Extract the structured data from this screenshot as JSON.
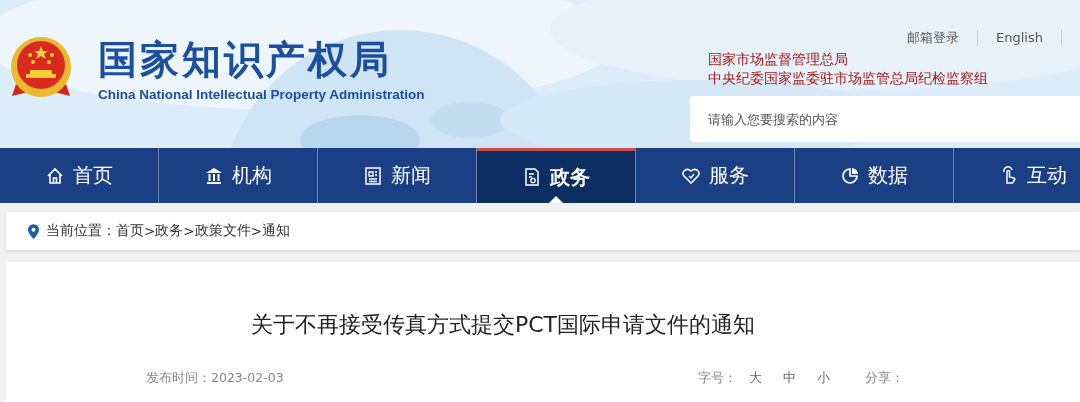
{
  "header": {
    "title": "国家知识产权局",
    "subtitle": "China National Intellectual Property Administration",
    "top_links": [
      "邮箱登录",
      "English"
    ],
    "affiliations": [
      "国家市场监督管理总局",
      "中央纪委国家监委驻市场监管总局纪检监察组"
    ],
    "search": {
      "placeholder": "请输入您要搜索的内容"
    }
  },
  "nav": [
    {
      "label": "首页",
      "selected": false
    },
    {
      "label": "机构",
      "selected": false
    },
    {
      "label": "新闻",
      "selected": false
    },
    {
      "label": "政务",
      "selected": true
    },
    {
      "label": "服务",
      "selected": false
    },
    {
      "label": "数据",
      "selected": false
    },
    {
      "label": "互动",
      "selected": false
    }
  ],
  "breadcrumb": {
    "label": "当前位置：",
    "path": [
      "首页",
      ">",
      "政务",
      ">",
      "政策文件",
      ">",
      "通知"
    ]
  },
  "article": {
    "title": "关于不再接受传真方式提交PCT国际申请文件的通知",
    "date": "发布时间：2023-02-03",
    "font_size_label": "字号：",
    "font_sizes": [
      "大",
      "中",
      "小"
    ],
    "share_label": "分享："
  }
}
